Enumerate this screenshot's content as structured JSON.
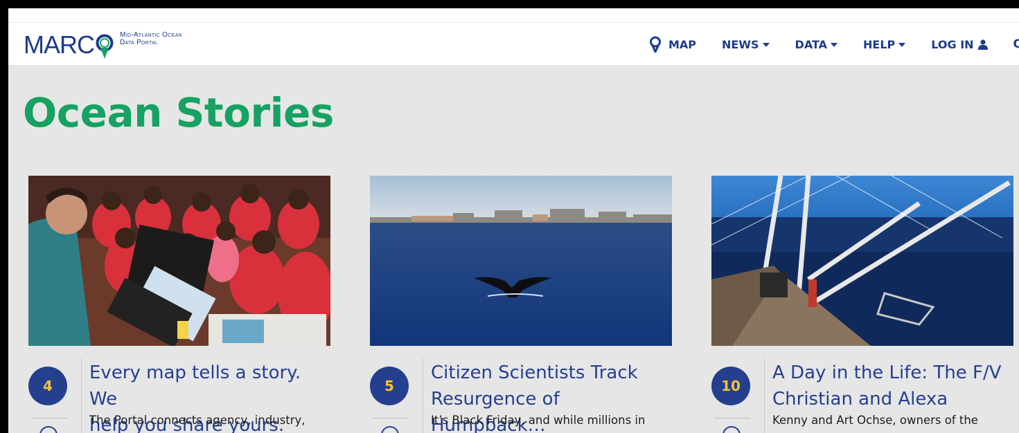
{
  "logo": {
    "wordmark": "MARC",
    "tagline_line1": "Mid-Atlantic Ocean",
    "tagline_line2": "Data Portal"
  },
  "nav": {
    "map": "MAP",
    "news": "NEWS",
    "data": "DATA",
    "help": "HELP",
    "login": "LOG IN",
    "search_glyph": "Q"
  },
  "page": {
    "title": "Ocean Stories"
  },
  "cards": [
    {
      "count": "4",
      "title_line1": "Every map tells a story. We",
      "title_line2": "help you share yours.",
      "excerpt": "The Portal connects agency, industry,"
    },
    {
      "count": "5",
      "title_line1": "Citizen Scientists Track",
      "title_line2": "Resurgence of Humpback…",
      "excerpt": "It’s Black Friday, and while millions in"
    },
    {
      "count": "10",
      "title_line1": "A Day in the Life: The F/V",
      "title_line2": "Christian and Alexa",
      "excerpt": "Kenny and Art Ochse, owners of the"
    }
  ],
  "colors": {
    "brand_navy": "#1e3a8a",
    "title_green": "#16a262",
    "badge_navy": "#253f8f",
    "badge_gold": "#f3c33a",
    "page_bg": "#e6e6e6"
  },
  "icons": [
    "map-pin-icon",
    "caret-down-icon",
    "user-icon",
    "search-icon",
    "comment-icon"
  ]
}
